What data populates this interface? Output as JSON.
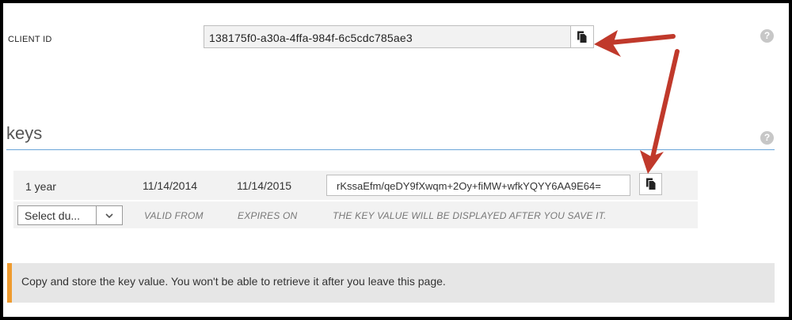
{
  "client": {
    "label": "CLIENT ID",
    "value": "138175f0-a30a-4ffa-984f-6c5cdc785ae3",
    "help": "?"
  },
  "keys": {
    "title": "keys",
    "help": "?",
    "row": {
      "duration": "1 year",
      "valid_from": "11/14/2014",
      "expires_on": "11/14/2015",
      "key_value": "rKssaEfm/qeDY9fXwqm+2Oy+fiMW+wfkYQYY6AA9E64="
    },
    "new_row": {
      "select_placeholder": "Select du...",
      "valid_from_header": "VALID FROM",
      "expires_on_header": "EXPIRES ON",
      "key_value_header": "THE KEY VALUE WILL BE DISPLAYED AFTER YOU SAVE IT."
    }
  },
  "notice": {
    "message": "Copy and store the key value. You won't be able to retrieve it after you leave this page."
  },
  "colors": {
    "accent_rule": "#6aa5d8",
    "notice_bar": "#ef9b2f",
    "annotation_arrow": "#c0392b"
  }
}
